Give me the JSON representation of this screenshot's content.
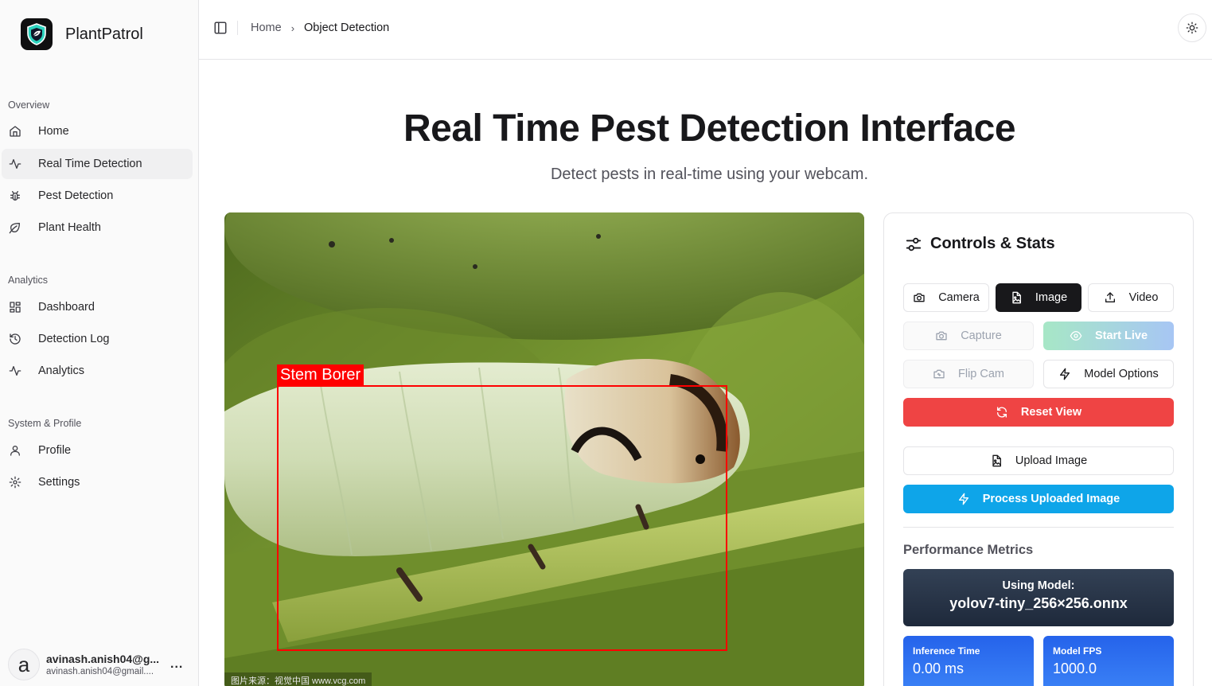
{
  "app": {
    "name": "PlantPatrol"
  },
  "colors": {
    "accent_red": "#ef4444",
    "accent_blue": "#0ea5e9",
    "detection_red": "#ff0000",
    "model_box": "#1e293b",
    "stat_box": "#2563eb"
  },
  "sidebar": {
    "groups": [
      {
        "label": "Overview",
        "items": [
          {
            "label": "Home",
            "icon": "home-icon"
          },
          {
            "label": "Real Time Detection",
            "icon": "activity-icon",
            "active": true
          },
          {
            "label": "Pest Detection",
            "icon": "bug-icon"
          },
          {
            "label": "Plant Health",
            "icon": "leaf-icon"
          }
        ]
      },
      {
        "label": "Analytics",
        "items": [
          {
            "label": "Dashboard",
            "icon": "dashboard-icon"
          },
          {
            "label": "Detection Log",
            "icon": "history-icon"
          },
          {
            "label": "Analytics",
            "icon": "activity-icon"
          }
        ]
      },
      {
        "label": "System & Profile",
        "items": [
          {
            "label": "Profile",
            "icon": "user-icon"
          },
          {
            "label": "Settings",
            "icon": "gear-icon"
          }
        ]
      }
    ],
    "user": {
      "avatar_letter": "a",
      "name": "avinash.anish04@g...",
      "email": "avinash.anish04@gmail....",
      "more": "..."
    }
  },
  "header": {
    "breadcrumb": {
      "home": "Home",
      "separator": "›",
      "current": "Object Detection"
    }
  },
  "main": {
    "title": "Real Time Pest Detection Interface",
    "subtitle": "Detect pests in real-time using your webcam.",
    "detection": {
      "label": "Stem Borer"
    },
    "watermark": "图片来源：视觉中国 www.vcg.com"
  },
  "controls": {
    "title": "Controls & Stats",
    "buttons": {
      "camera": "Camera",
      "image": "Image",
      "video": "Video",
      "capture": "Capture",
      "start_live": "Start Live",
      "flip_cam": "Flip Cam",
      "model_options": "Model Options",
      "reset_view": "Reset View",
      "upload_image": "Upload Image",
      "process_uploaded": "Process Uploaded Image"
    },
    "performance": {
      "title": "Performance Metrics",
      "model_label": "Using Model:",
      "model_value": "yolov7-tiny_256×256.onnx",
      "inference_label": "Inference Time",
      "inference_value": "0.00 ms",
      "fps_label": "Model FPS",
      "fps_value": "1000.0"
    }
  }
}
